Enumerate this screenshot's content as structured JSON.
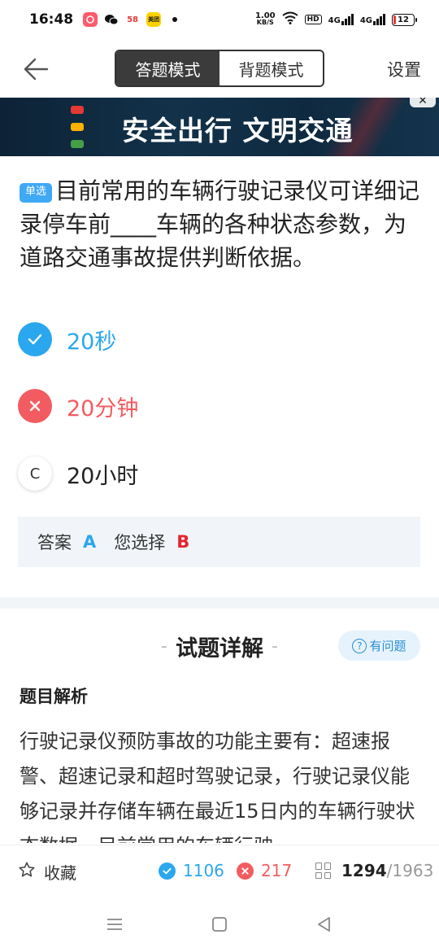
{
  "status_bar": {
    "time": "16:48",
    "apps": [
      {
        "name": "app-icon-1",
        "text": "",
        "color": "#ff5a6b"
      },
      {
        "name": "wechat-icon",
        "text": "",
        "color": "#ffffff"
      },
      {
        "name": "58-icon",
        "text": "58",
        "color": "#ffffff"
      },
      {
        "name": "meituan-icon",
        "text": "美团",
        "color": "#ffd100"
      }
    ],
    "net_speed_value": "1.00",
    "net_speed_unit": "KB/S",
    "hd_label": "HD",
    "signal_1_label": "4G",
    "signal_2_label": "4G",
    "battery_level": "12",
    "battery_fraction": 0.12
  },
  "nav": {
    "back_icon": "arrow-left-icon",
    "mode_exam": "答题模式",
    "mode_recite": "背题模式",
    "active_mode": "exam",
    "settings": "设置"
  },
  "banner": {
    "text": "安全出行 文明交通",
    "close": "✕",
    "light_colors": [
      "#e53935",
      "#ffb300",
      "#43a047"
    ]
  },
  "question": {
    "type_label": "单选",
    "text": "目前常用的车辆行驶记录仪可详细记录停车前____车辆的各种状态参数，为道路交通事故提供判断依据。"
  },
  "options": [
    {
      "letter": "A",
      "text": "20秒",
      "state": "correct"
    },
    {
      "letter": "B",
      "text": "20分钟",
      "state": "wrong"
    },
    {
      "letter": "C",
      "text": "20小时",
      "state": "plain"
    }
  ],
  "answer": {
    "label": "答案",
    "correct": "A",
    "your_choice_label": "您选择",
    "your_choice": "B"
  },
  "explanation": {
    "title": "试题详解",
    "feedback_label": "有问题",
    "subtitle": "题目解析",
    "text": "行驶记录仪预防事故的功能主要有：超速报警、超速记录和超时驾驶记录，行驶记录仪能够记录并存储车辆在最近15日内的车辆行驶状态数据。目前常用的车辆行驶"
  },
  "bottom_bar": {
    "favorite_label": "收藏",
    "correct_count": "1106",
    "wrong_count": "217",
    "current": "1294",
    "total": "/1963"
  },
  "colors": {
    "accent_blue": "#2aa7ee",
    "wrong_red": "#f25c60",
    "dark_toggle": "#3b3b3b"
  }
}
